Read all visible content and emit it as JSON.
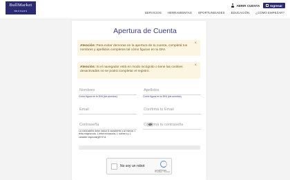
{
  "header": {
    "logo_line1": "BullMarket",
    "logo_line2": "BROKERS",
    "open_account": "ABRIR CUENTA",
    "login": "Ingresar",
    "nav": [
      "SERVICIOS",
      "HERRAMIENTAS",
      "OPORTUNIDADES",
      "EDUCACIÓN",
      "¿CÓMO EMPEZAR?"
    ]
  },
  "page": {
    "title": "Apertura de Cuenta"
  },
  "alerts": [
    {
      "prefix": "Atención:",
      "text": " Para evitar demoras en la apertura de tu cuenta, completá tus nombres y apellidos completos tal cómo figuran en tu DNI."
    },
    {
      "prefix": "Atención:",
      "text": " Si el navegador está en modo incógnito o tiene las cookies desactivadas no se podrá completar el registro."
    }
  ],
  "form": {
    "nombres": {
      "placeholder": "Nombres",
      "hint": "Como figura en tu DNI (sin acentos)"
    },
    "apellidos": {
      "placeholder": "Apellidos",
      "hint": "Como figura en tu DNI (sin acentos)"
    },
    "email": {
      "placeholder": "Email"
    },
    "confirm_email": {
      "placeholder": "Confirmá tu Email"
    },
    "password": {
      "placeholder": "Contraseña"
    },
    "confirm_password": {
      "placeholder": "Confirmá tu contraseña"
    },
    "password_hint": "La contraseña debe incluir 8 caracteres y al menos 1 letra mayúscula, 1 letra minúscula, 1 número y 1 caracter especial(@!%?&"
  },
  "captcha": {
    "label": "No soy un robot",
    "brand": "reCAPTCHA",
    "terms": "Privacidad - Términos"
  },
  "icons": {
    "alert_close": "close-icon",
    "password_toggle": "eye-icon",
    "user": "person-icon",
    "login": "lock-icon"
  },
  "colors": {
    "brand": "#2b2a73",
    "alert_bg": "#fbf5e1",
    "title": "#3a3a8c"
  }
}
